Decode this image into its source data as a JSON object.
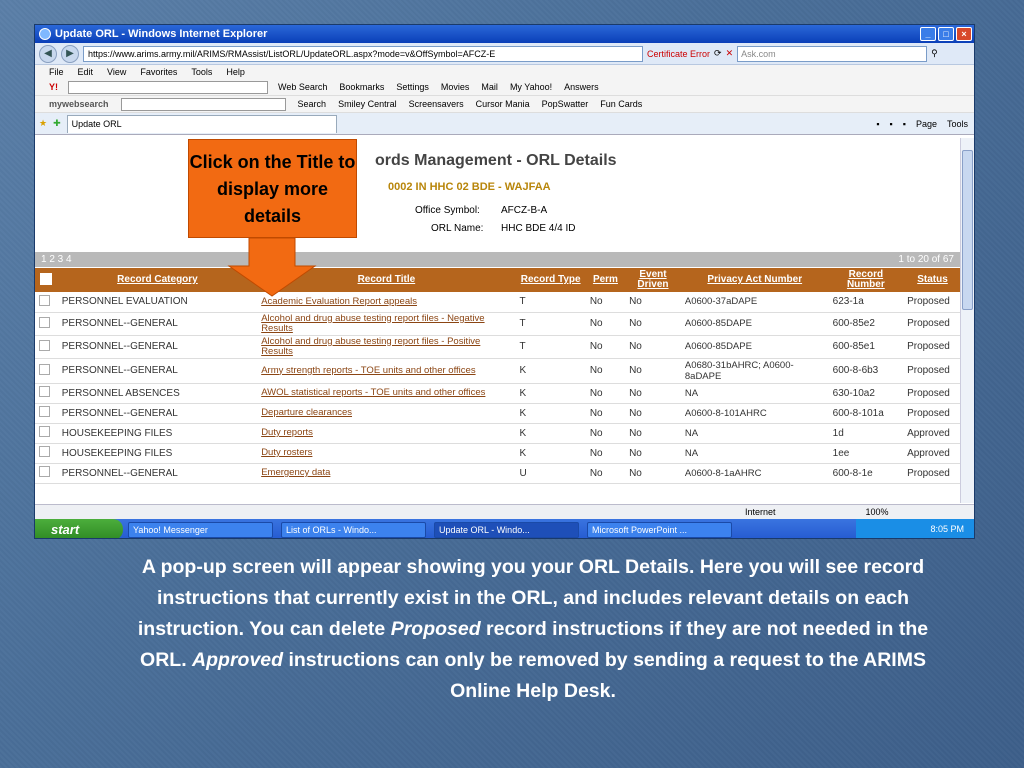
{
  "window": {
    "title": "Update ORL - Windows Internet Explorer"
  },
  "address": {
    "url": "https://www.arims.army.mil/ARIMS/RMAssist/ListORL/UpdateORL.aspx?mode=v&OffSymbol=AFCZ-E",
    "cert": "Certificate Error",
    "search_placeholder": "Ask.com"
  },
  "menu": [
    "File",
    "Edit",
    "View",
    "Favorites",
    "Tools",
    "Help"
  ],
  "yahoo_toolbar": [
    "Web Search",
    "Bookmarks",
    "Settings",
    "Movies",
    "Mail",
    "My Yahoo!",
    "Answers"
  ],
  "mws_toolbar": [
    "mywebsearch",
    "Search",
    "Smiley Central",
    "Screensavers",
    "Cursor Mania",
    "PopSwatter",
    "Fun Cards"
  ],
  "tab": {
    "label": "Update ORL"
  },
  "tab_tools": [
    "Page",
    "Tools"
  ],
  "page": {
    "title": "ords Management - ORL Details",
    "unit": "0002 IN HHC 02 BDE - WAJFAA",
    "office_symbol_label": "Office Symbol:",
    "office_symbol": "AFCZ-B-A",
    "orl_name_label": "ORL Name:",
    "orl_name": "HHC BDE 4/4 ID",
    "pages": "1 2 3 4",
    "count": "1 to 20 of 67"
  },
  "table": {
    "headers": [
      "Record Category",
      "Record Title",
      "Record Type",
      "Perm",
      "Event Driven",
      "Privacy Act Number",
      "Record Number",
      "Status"
    ],
    "rows": [
      [
        "PERSONNEL EVALUATION",
        "Academic Evaluation Report appeals",
        "T",
        "No",
        "No",
        "A0600-37aDAPE",
        "623-1a",
        "Proposed"
      ],
      [
        "PERSONNEL--GENERAL",
        "Alcohol and drug abuse testing report files - Negative Results",
        "T",
        "No",
        "No",
        "A0600-85DAPE",
        "600-85e2",
        "Proposed"
      ],
      [
        "PERSONNEL--GENERAL",
        "Alcohol and drug abuse testing report files - Positive Results",
        "T",
        "No",
        "No",
        "A0600-85DAPE",
        "600-85e1",
        "Proposed"
      ],
      [
        "PERSONNEL--GENERAL",
        "Army strength reports - TOE units and other offices",
        "K",
        "No",
        "No",
        "A0680-31bAHRC; A0600-8aDAPE",
        "600-8-6b3",
        "Proposed"
      ],
      [
        "PERSONNEL ABSENCES",
        "AWOL statistical reports - TOE units and other offices",
        "K",
        "No",
        "No",
        "NA",
        "630-10a2",
        "Proposed"
      ],
      [
        "PERSONNEL--GENERAL",
        "Departure clearances",
        "K",
        "No",
        "No",
        "A0600-8-101AHRC",
        "600-8-101a",
        "Proposed"
      ],
      [
        "HOUSEKEEPING FILES",
        "Duty reports",
        "K",
        "No",
        "No",
        "NA",
        "1d",
        "Approved"
      ],
      [
        "HOUSEKEEPING FILES",
        "Duty rosters",
        "K",
        "No",
        "No",
        "NA",
        "1ee",
        "Approved"
      ],
      [
        "PERSONNEL--GENERAL",
        "Emergency data",
        "U",
        "No",
        "No",
        "A0600-8-1aAHRC",
        "600-8-1e",
        "Proposed"
      ]
    ]
  },
  "statusbar": {
    "zone": "Internet",
    "zoom": "100%"
  },
  "taskbar": {
    "start": "start",
    "tasks": [
      "Yahoo! Messenger",
      "List of ORLs - Windo...",
      "Update ORL - Windo...",
      "Microsoft PowerPoint ..."
    ],
    "clock": "8:05 PM"
  },
  "callout": "Click on the Title to display more details",
  "caption": {
    "p1": "A pop-up screen will appear showing you your ORL Details.  Here you will see record instructions that currently exist in the ORL, and includes relevant details on each instruction. You can delete ",
    "em1": "Proposed",
    "p2": " record instructions if they are not needed in the ORL. ",
    "em2": "Approved",
    "p3": " instructions can only be removed by sending a request to the ARIMS Online Help Desk."
  }
}
